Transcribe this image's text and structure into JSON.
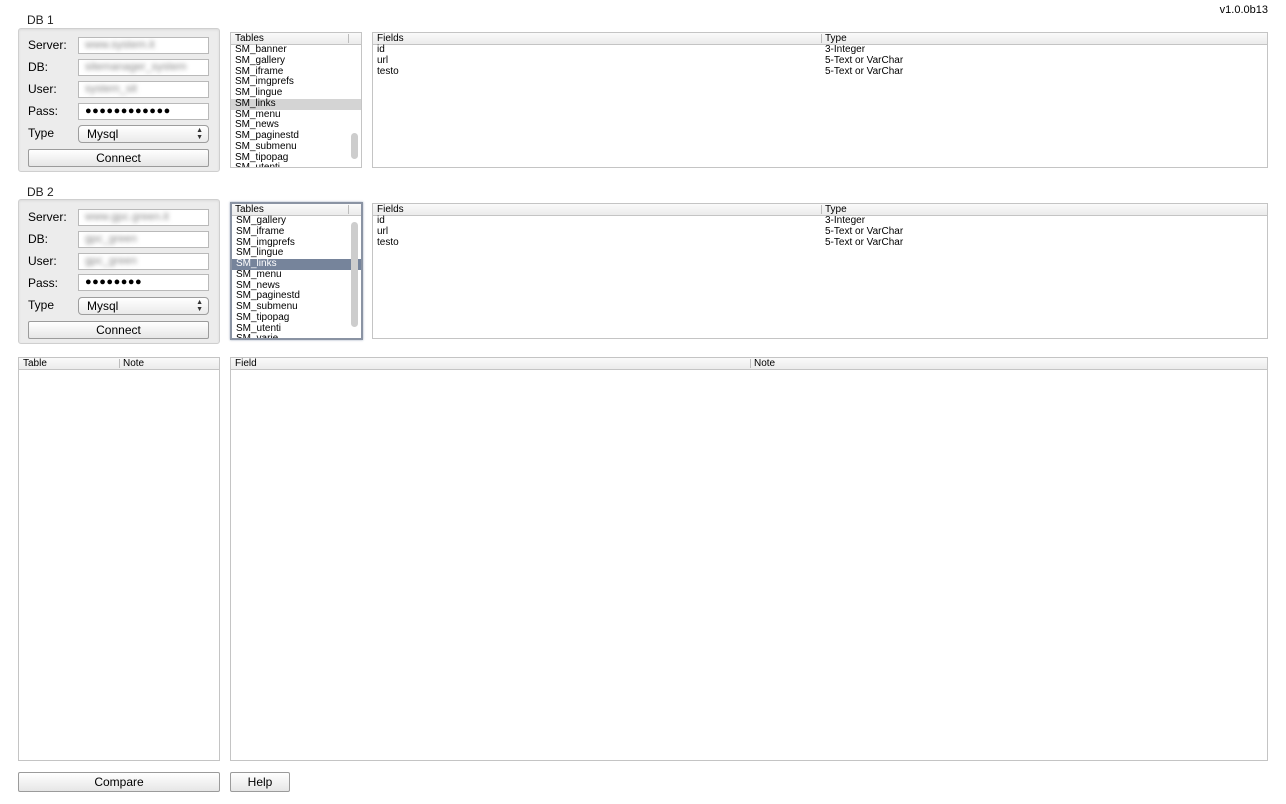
{
  "app": {
    "version": "v1.0.0b13"
  },
  "db1": {
    "title": "DB 1",
    "labels": {
      "server": "Server:",
      "db": "DB:",
      "user": "User:",
      "pass": "Pass:",
      "type": "Type"
    },
    "server_value": "www.system.it",
    "db_value": "sitemanager_system",
    "user_value": "system_sit",
    "pass_value": "●●●●●●●●●●●●",
    "type_value": "Mysql",
    "connect_label": "Connect",
    "tables": {
      "header": "Tables",
      "items": [
        "SM_banner",
        "SM_gallery",
        "SM_iframe",
        "SM_imgprefs",
        "SM_lingue",
        "SM_links",
        "SM_menu",
        "SM_news",
        "SM_paginestd",
        "SM_submenu",
        "SM_tipopag",
        "SM_utenti"
      ]
    },
    "fields": {
      "headers": {
        "field": "Fields",
        "type": "Type"
      },
      "rows": [
        {
          "name": "id",
          "type": "3-Integer"
        },
        {
          "name": "url",
          "type": "5-Text or VarChar"
        },
        {
          "name": "testo",
          "type": "5-Text or VarChar"
        }
      ]
    }
  },
  "db2": {
    "title": "DB 2",
    "labels": {
      "server": "Server:",
      "db": "DB:",
      "user": "User:",
      "pass": "Pass:",
      "type": "Type"
    },
    "server_value": "www.gpc.green.it",
    "db_value": "gpc_green",
    "user_value": "gpc_green",
    "pass_value": "●●●●●●●●",
    "type_value": "Mysql",
    "connect_label": "Connect",
    "tables": {
      "header": "Tables",
      "items": [
        "SM_gallery",
        "SM_iframe",
        "SM_imgprefs",
        "SM_lingue",
        "SM_links",
        "SM_menu",
        "SM_news",
        "SM_paginestd",
        "SM_submenu",
        "SM_tipopag",
        "SM_utenti",
        "SM_varie"
      ]
    },
    "fields": {
      "headers": {
        "field": "Fields",
        "type": "Type"
      },
      "rows": [
        {
          "name": "id",
          "type": "3-Integer"
        },
        {
          "name": "url",
          "type": "5-Text or VarChar"
        },
        {
          "name": "testo",
          "type": "5-Text or VarChar"
        }
      ]
    }
  },
  "results": {
    "table_headers": {
      "table": "Table",
      "note": "Note"
    },
    "field_headers": {
      "field": "Field",
      "note": "Note"
    }
  },
  "buttons": {
    "compare": "Compare",
    "help": "Help"
  }
}
